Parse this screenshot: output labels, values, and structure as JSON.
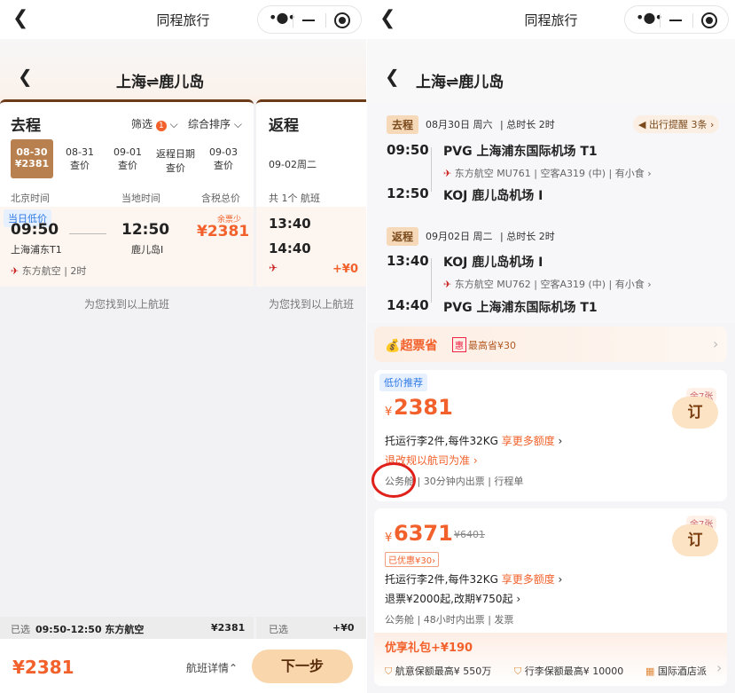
{
  "app_title": "同程旅行",
  "route": "上海⇌鹿儿岛",
  "left": {
    "outbound": {
      "title": "去程",
      "filter": "筛选",
      "filter_count": "1",
      "sort": "综合排序",
      "dates": [
        {
          "d": "08-30",
          "p": "¥2381",
          "active": true
        },
        {
          "d": "08-31",
          "p": "查价"
        },
        {
          "d": "09-01",
          "p": "查价"
        },
        {
          "d": "返程日期",
          "p": "查价"
        },
        {
          "d": "09-03",
          "p": "查价"
        }
      ],
      "col_beijing": "北京时间",
      "col_local": "当地时间",
      "col_price": "含税总价",
      "flight": {
        "badge": "当日低价",
        "dep": "09:50",
        "arr": "12:50",
        "dep_ap": "上海浦东T1",
        "arr_ap": "鹿儿岛I",
        "price": "¥2381",
        "low": "余票少",
        "airline": "东方航空",
        "dur": "2时"
      },
      "found": "为您找到以上航班"
    },
    "return": {
      "title": "返程",
      "date": "09-02周二",
      "count": "共 1个 航班",
      "dep": "13:40",
      "arr": "14:40",
      "price": "+¥0",
      "found": "为您找到以上航班"
    },
    "selected": {
      "label": "已选",
      "flight": "09:50-12:50 东方航空",
      "price": "¥2381",
      "label2": "已选",
      "price2": "+¥0"
    },
    "bottom": {
      "total": "¥2381",
      "detail": "航班详情",
      "next": "下一步"
    }
  },
  "right": {
    "out": {
      "tag": "去程",
      "date": "08月30日 周六",
      "dur": "总时长 2时",
      "reminder": "出行提醒 3条",
      "dep_t": "09:50",
      "dep": "PVG 上海浦东国际机场 T1",
      "info": "东方航空 MU761 | 空客A319 (中) | 有小食",
      "arr_t": "12:50",
      "arr": "KOJ 鹿儿岛机场 I"
    },
    "ret": {
      "tag": "返程",
      "date": "09月02日 周二",
      "dur": "总时长 2时",
      "dep_t": "13:40",
      "dep": "KOJ 鹿儿岛机场 I",
      "info": "东方航空 MU762 | 空客A319 (中) | 有小食",
      "arr_t": "14:40",
      "arr": "PVG 上海浦东国际机场 T1"
    },
    "promo": {
      "name": "超票省",
      "tag": "惠",
      "text": "最高省¥30"
    },
    "offer1": {
      "badge": "低价推荐",
      "price": "2381",
      "remain": "余7张",
      "book": "订",
      "bag": "托运行李2件,每件32KG",
      "more": "享更多额度",
      "rule": "退改规以航司为准",
      "cls": "公务舱",
      "issue": "30分钟内出票",
      "doc": "行程单"
    },
    "offer2": {
      "price": "6371",
      "orig": "¥6401",
      "save": "已优惠¥30",
      "remain": "余7张",
      "book": "订",
      "bag": "托运行李2件,每件32KG",
      "more": "享更多额度",
      "rule": "退票¥2000起,改期¥750起",
      "cls": "公务舱",
      "issue": "48小时内出票",
      "doc": "发票"
    },
    "gift": {
      "title": "优享礼包+¥190",
      "i1": "航意保额最高¥ 550万",
      "i2": "行李保额最高¥ 10000",
      "i3": "国际酒店派"
    }
  },
  "colors": {
    "accent": "#f2612b",
    "brand": "#b8804e",
    "circle": "#e0201a"
  }
}
